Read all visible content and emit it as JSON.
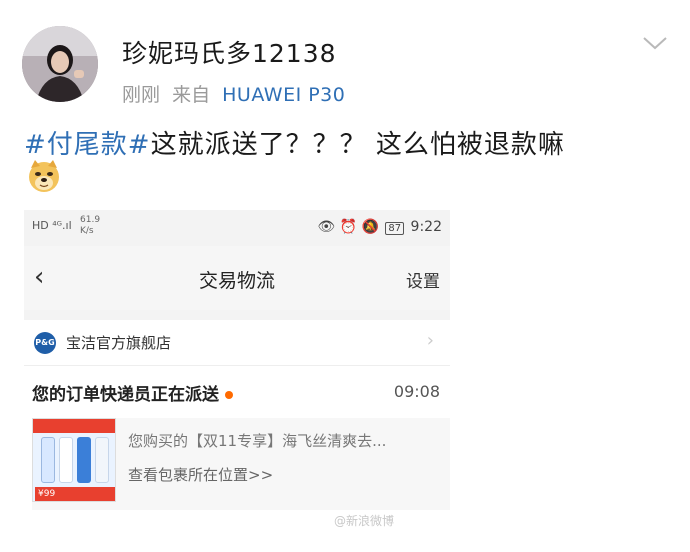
{
  "post": {
    "username": "珍妮玛氏多12138",
    "time": "刚刚",
    "source_prefix": "来自",
    "device": "HUAWEI P30",
    "topic": "#付尾款#",
    "text": "这就派送了？？？ 这么怕被退款嘛"
  },
  "icons": {
    "options": "chevron-down-icon",
    "emoji": "doge-emoji-icon"
  },
  "screenshot": {
    "status_left": "HD ⁴ᴳ.ıl",
    "speed_value": "61.9",
    "speed_unit": "K/s",
    "status_right_icons": "👁 ⏰ 🔕",
    "battery": "87",
    "clock": "9:22",
    "nav": {
      "back": "‹",
      "title": "交易物流",
      "settings": "设置"
    },
    "store": {
      "logo_text": "P&G",
      "name": "宝洁官方旗舰店",
      "arrow": "›"
    },
    "order": {
      "status": "您的订单快递员正在派送",
      "time": "09:08"
    },
    "product": {
      "name": "您购买的【双11专享】海飞丝清爽去...",
      "link": "查看包裹所在位置>>",
      "thumb_price": "¥99"
    }
  },
  "watermark": "@新浪微博"
}
